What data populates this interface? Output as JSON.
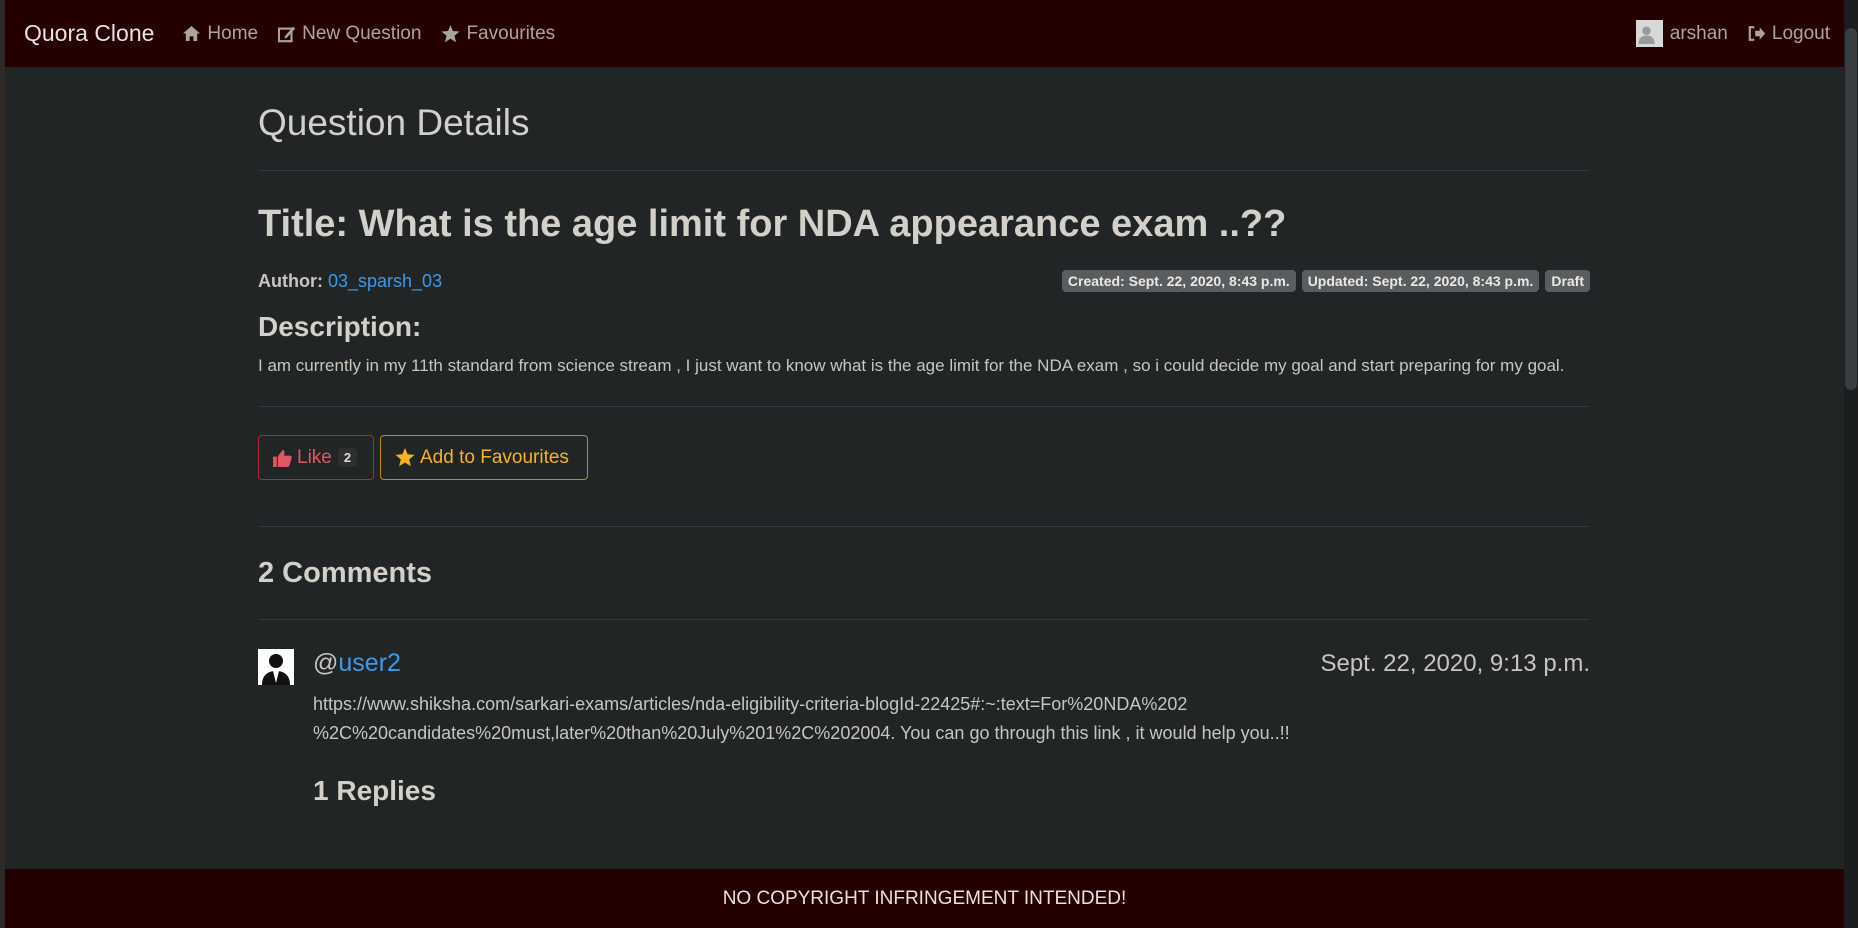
{
  "navbar": {
    "brand": "Quora Clone",
    "items": [
      {
        "label": "Home",
        "icon": "home-icon"
      },
      {
        "label": "New Question",
        "icon": "edit-icon"
      },
      {
        "label": "Favourites",
        "icon": "star-icon"
      }
    ],
    "user": {
      "name": "arshan",
      "icon": "user-avatar-icon"
    },
    "logout": {
      "label": "Logout",
      "icon": "sign-out-icon"
    }
  },
  "page": {
    "title": "Question Details"
  },
  "question": {
    "title": "Title: What is the age limit for NDA appearance exam ..??",
    "author_label": "Author:",
    "author": "03_sparsh_03",
    "created": "Created: Sept. 22, 2020, 8:43 p.m.",
    "updated": "Updated: Sept. 22, 2020, 8:43 p.m.",
    "status": "Draft",
    "description_heading": "Description:",
    "description": "I am currently in my 11th standard from science stream , I just want to know what is the age limit for the NDA exam , so i could decide my goal and start preparing for my goal."
  },
  "actions": {
    "like_label": "Like",
    "like_count": "2",
    "favourite_label": "Add to Favourites"
  },
  "comments": {
    "heading": "2 Comments",
    "items": [
      {
        "at": "@",
        "user": "user2",
        "date": "Sept. 22, 2020, 9:13 p.m.",
        "text": "https://www.shiksha.com/sarkari-exams/articles/nda-eligibility-criteria-blogId-22425#:~:text=For%20NDA%202 %2C%20candidates%20must,later%20than%20July%201%2C%202004. You can go through this link , it would help you..!!",
        "replies_heading": "1 Replies"
      }
    ]
  },
  "footer": {
    "text": "NO COPYRIGHT INFRINGEMENT INTENDED!"
  },
  "colors": {
    "navbar_bg": "#240000",
    "body_bg": "#222526",
    "link": "#3d9ae8",
    "like": "#e25563",
    "favourite": "#f5b324"
  }
}
